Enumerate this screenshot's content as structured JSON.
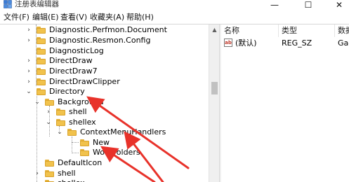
{
  "window": {
    "title": "注册表编辑器",
    "controls": {
      "minimize": "—",
      "maximize": "☐",
      "close": "✕"
    }
  },
  "menu": [
    "文件(F)",
    "编辑(E)",
    "查看(V)",
    "收藏夹(A)",
    "帮助(H)"
  ],
  "tree": {
    "items": [
      {
        "label": "Diagnostic.Perfmon.Document",
        "expander": "›"
      },
      {
        "label": "Diagnostic.Resmon.Config",
        "expander": "›"
      },
      {
        "label": "DiagnosticLog",
        "expander": ""
      },
      {
        "label": "DirectDraw",
        "expander": "›"
      },
      {
        "label": "DirectDraw7",
        "expander": "›"
      },
      {
        "label": "DirectDrawClipper",
        "expander": "›"
      },
      {
        "label": "Directory",
        "expander": "⌄"
      },
      {
        "label": "Background",
        "expander": "⌄"
      },
      {
        "label": "shell",
        "expander": "›"
      },
      {
        "label": "shellex",
        "expander": "⌄"
      },
      {
        "label": "ContextMenuHandlers",
        "expander": "⌄"
      },
      {
        "label": "New",
        "expander": ""
      },
      {
        "label": "WorkFolders",
        "expander": ""
      },
      {
        "label": "DefaultIcon",
        "expander": ""
      },
      {
        "label": "shell",
        "expander": "›"
      },
      {
        "label": "shellex",
        "expander": "›"
      }
    ]
  },
  "values": {
    "columns": [
      "名称",
      "类型",
      "数据"
    ],
    "rows": [
      {
        "name": "(默认)",
        "type": "REG_SZ",
        "data": "Gac"
      }
    ]
  },
  "colors": {
    "folder": "#f1c24c",
    "arrow": "#e8322a"
  }
}
